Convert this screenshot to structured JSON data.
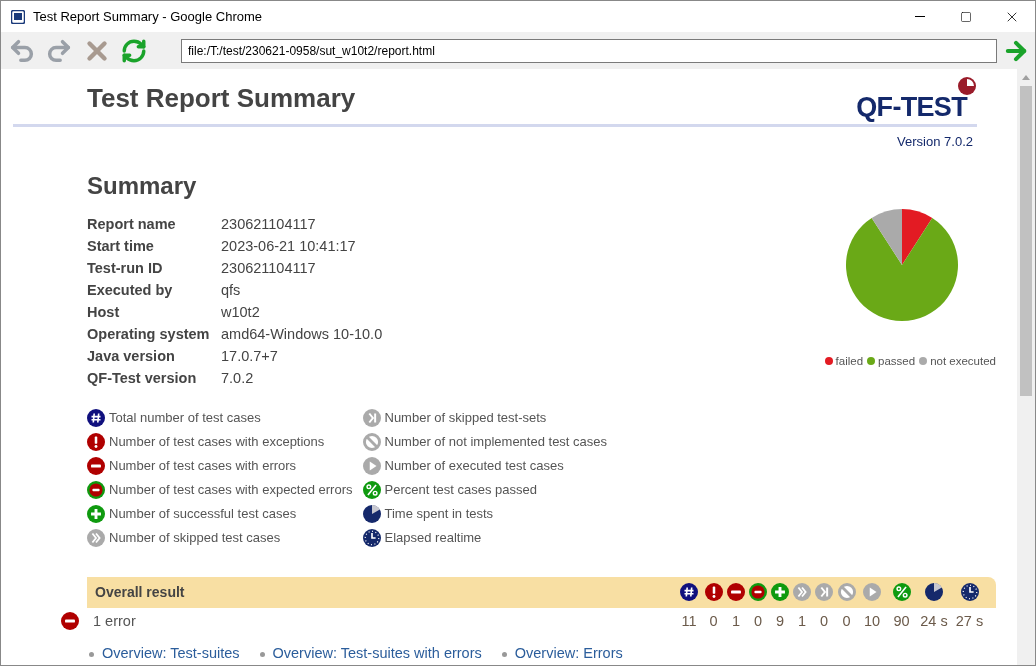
{
  "window": {
    "title": "Test Report Summary - Google Chrome"
  },
  "toolbar": {
    "address": "file:/T:/test/230621-0958/sut_w10t2/report.html"
  },
  "report": {
    "title": "Test Report Summary",
    "logo": "QF-TEST",
    "version": "Version 7.0.2"
  },
  "summary": {
    "heading": "Summary",
    "fields": [
      {
        "label": "Report name",
        "value": "230621104117"
      },
      {
        "label": "Start time",
        "value": "2023-06-21 10:41:17"
      },
      {
        "label": "Test-run ID",
        "value": "230621104117"
      },
      {
        "label": "Executed by",
        "value": "qfs"
      },
      {
        "label": "Host",
        "value": "w10t2"
      },
      {
        "label": "Operating system",
        "value": "amd64-Windows 10-10.0"
      },
      {
        "label": "Java version",
        "value": "17.0.7+7"
      },
      {
        "label": "QF-Test version",
        "value": "7.0.2"
      }
    ]
  },
  "pie_legend": [
    {
      "label": "failed",
      "color": "#e31b23"
    },
    {
      "label": "passed",
      "color": "#6aa917"
    },
    {
      "label": "not executed",
      "color": "#aaaaaa"
    }
  ],
  "icon_legend": [
    {
      "kind": "total",
      "label": "Total number of test cases"
    },
    {
      "kind": "exception",
      "label": "Number of test cases with exceptions"
    },
    {
      "kind": "error",
      "label": "Number of test cases with errors"
    },
    {
      "kind": "expected_error",
      "label": "Number of test cases with expected errors"
    },
    {
      "kind": "success",
      "label": "Number of successful test cases"
    },
    {
      "kind": "skipped",
      "label": "Number of skipped test cases"
    },
    {
      "kind": "skipped_set",
      "label": "Number of skipped test-sets"
    },
    {
      "kind": "not_implemented",
      "label": "Number of not implemented test cases"
    },
    {
      "kind": "executed",
      "label": "Number of executed test cases"
    },
    {
      "kind": "percent",
      "label": "Percent test cases passed"
    },
    {
      "kind": "time",
      "label": "Time spent in tests"
    },
    {
      "kind": "elapsed",
      "label": "Elapsed realtime"
    }
  ],
  "overall_result": {
    "heading": "Overall result",
    "columns": [
      {
        "kind": "total",
        "value": "11"
      },
      {
        "kind": "exception",
        "value": "0"
      },
      {
        "kind": "error",
        "value": "1"
      },
      {
        "kind": "expected_error",
        "value": "0"
      },
      {
        "kind": "success",
        "value": "9"
      },
      {
        "kind": "skipped",
        "value": "1"
      },
      {
        "kind": "skipped_set",
        "value": "0"
      },
      {
        "kind": "not_implemented",
        "value": "0"
      },
      {
        "kind": "executed",
        "value": "10"
      },
      {
        "kind": "percent",
        "value": "90"
      },
      {
        "kind": "time",
        "value": "24 s"
      },
      {
        "kind": "elapsed",
        "value": "27 s"
      }
    ],
    "status": {
      "kind": "error",
      "text": "1 error"
    }
  },
  "links": [
    "Overview: Test-suites",
    "Overview: Test-suites with errors",
    "Overview: Errors"
  ]
}
